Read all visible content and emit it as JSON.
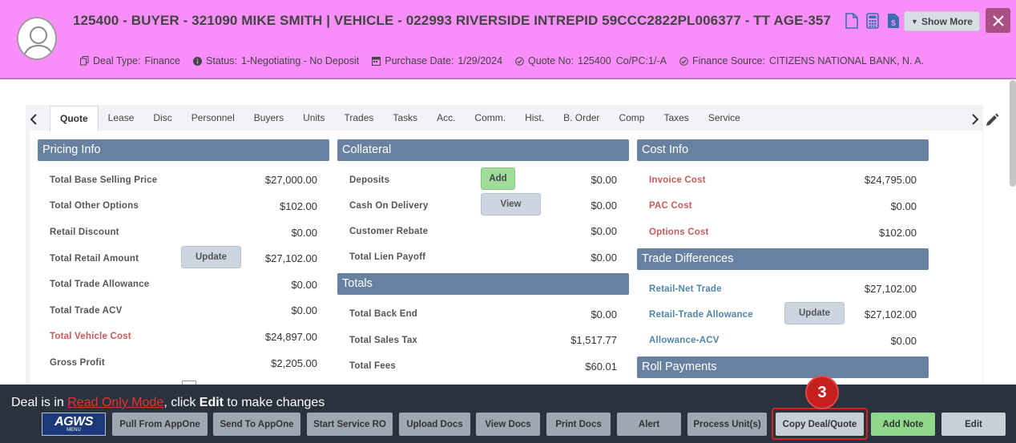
{
  "header": {
    "title": "125400 - BUYER - 321090 MIKE SMITH | VEHICLE - 022993 RIVERSIDE INTREPID 59CCC2822PL006377 - TT AGE-357",
    "deal_type_label": "Deal Type:",
    "deal_type": "Finance",
    "status_label": "Status:",
    "status": "1-Negotiating - No Deposit",
    "purchase_date_label": "Purchase Date:",
    "purchase_date": "1/29/2024",
    "quote_no_label": "Quote No:",
    "quote_no": "125400",
    "copc": "Co/PC:1/-A",
    "finance_source_label": "Finance Source:",
    "finance_source": "CITIZENS NATIONAL BANK, N. A.",
    "show_more": "Show More",
    "accent": "#f98df9"
  },
  "tabs": [
    "Quote",
    "Lease",
    "Disc",
    "Personnel",
    "Buyers",
    "Units",
    "Trades",
    "Tasks",
    "Acc.",
    "Comm.",
    "Hist.",
    "B. Order",
    "Comp",
    "Taxes",
    "Service"
  ],
  "pricing": {
    "title": "Pricing Info",
    "rows": [
      {
        "label": "Total Base Selling Price",
        "value": "$27,000.00"
      },
      {
        "label": "Total Other Options",
        "value": "$102.00"
      },
      {
        "label": "Retail Discount",
        "value": "$0.00"
      },
      {
        "label": "Total Retail Amount",
        "value": "$27,102.00"
      },
      {
        "label": "Total Trade Allowance",
        "value": "$0.00"
      },
      {
        "label": "Total Trade ACV",
        "value": "$0.00"
      },
      {
        "label": "Total Vehicle Cost",
        "value": "$24,897.00"
      },
      {
        "label": "Gross Profit",
        "value": "$2,205.00"
      }
    ],
    "update_label": "Update"
  },
  "collateral": {
    "title": "Collateral",
    "rows": [
      {
        "label": "Deposits",
        "value": "$0.00"
      },
      {
        "label": "Cash On Delivery",
        "value": "$0.00"
      },
      {
        "label": "Customer Rebate",
        "value": "$0.00"
      },
      {
        "label": "Total Lien Payoff",
        "value": "$0.00"
      }
    ],
    "add_label": "Add",
    "view_label": "View"
  },
  "totals": {
    "title": "Totals",
    "rows": [
      {
        "label": "Total Back End",
        "value": "$0.00"
      },
      {
        "label": "Total Sales Tax",
        "value": "$1,517.77"
      },
      {
        "label": "Total Fees",
        "value": "$60.01"
      }
    ]
  },
  "cost_info": {
    "title": "Cost Info",
    "rows": [
      {
        "label": "Invoice Cost",
        "value": "$24,795.00"
      },
      {
        "label": "PAC Cost",
        "value": "$0.00"
      },
      {
        "label": "Options Cost",
        "value": "$102.00"
      }
    ]
  },
  "trade_diff": {
    "title": "Trade Differences",
    "rows": [
      {
        "label": "Retail-Net Trade",
        "value": "$27,102.00"
      },
      {
        "label": "Retail-Trade Allowance",
        "value": "$27,102.00"
      },
      {
        "label": "Allowance-ACV",
        "value": "$0.00"
      }
    ],
    "update_label": "Update"
  },
  "roll_payments": {
    "title": "Roll Payments"
  },
  "footer": {
    "msg_prefix": "Deal is in ",
    "msg_mode": "Read Only Mode",
    "msg_mid": ", click ",
    "msg_edit": "Edit",
    "msg_suffix": " to make changes",
    "logo_main": "AGWS",
    "logo_sub": "MENU",
    "buttons": [
      "Pull From AppOne",
      "Send To AppOne",
      "Start Service RO",
      "Upload Docs",
      "View Docs",
      "Print Docs",
      "Alert",
      "Process Unit(s)",
      "Copy Deal/Quote",
      "Add Note",
      "Edit"
    ],
    "step_badge": "3"
  }
}
